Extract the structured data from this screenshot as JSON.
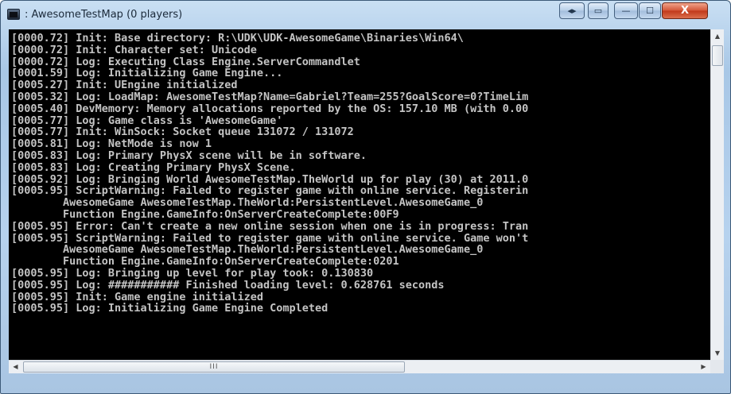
{
  "window": {
    "title": ": AwesomeTestMap (0 players)"
  },
  "controls": {
    "arrows_label": "◂▸",
    "restore_small_label": "▭",
    "minimize_label": "—",
    "maximize_label": "☐",
    "close_label": "X"
  },
  "console": {
    "lines": [
      "[0000.72] Init: Base directory: R:\\UDK\\UDK-AwesomeGame\\Binaries\\Win64\\",
      "[0000.72] Init: Character set: Unicode",
      "[0000.72] Log: Executing Class Engine.ServerCommandlet",
      "[0001.59] Log: Initializing Game Engine...",
      "[0005.27] Init: UEngine initialized",
      "[0005.32] Log: LoadMap: AwesomeTestMap?Name=Gabriel?Team=255?GoalScore=0?TimeLim",
      "[0005.40] DevMemory: Memory allocations reported by the OS: 157.10 MB (with 0.00",
      "[0005.77] Log: Game class is 'AwesomeGame'",
      "[0005.77] Init: WinSock: Socket queue 131072 / 131072",
      "[0005.81] Log: NetMode is now 1",
      "[0005.83] Log: Primary PhysX scene will be in software.",
      "[0005.83] Log: Creating Primary PhysX Scene.",
      "[0005.92] Log: Bringing World AwesomeTestMap.TheWorld up for play (30) at 2011.0",
      "[0005.95] ScriptWarning: Failed to register game with online service. Registerin",
      "        AwesomeGame AwesomeTestMap.TheWorld:PersistentLevel.AwesomeGame_0",
      "        Function Engine.GameInfo:OnServerCreateComplete:00F9",
      "[0005.95] Error: Can't create a new online session when one is in progress: Tran",
      "[0005.95] ScriptWarning: Failed to register game with online service. Game won't",
      "        AwesomeGame AwesomeTestMap.TheWorld:PersistentLevel.AwesomeGame_0",
      "        Function Engine.GameInfo:OnServerCreateComplete:0201",
      "[0005.95] Log: Bringing up level for play took: 0.130830",
      "[0005.95] Log: ########### Finished loading level: 0.628761 seconds",
      "[0005.95] Init: Game engine initialized",
      "[0005.95] Log: Initializing Game Engine Completed"
    ]
  },
  "scrollbars": {
    "up_arrow": "▲",
    "down_arrow": "▼",
    "left_arrow": "◀",
    "right_arrow": "▶",
    "hthumb_grip": "III"
  }
}
